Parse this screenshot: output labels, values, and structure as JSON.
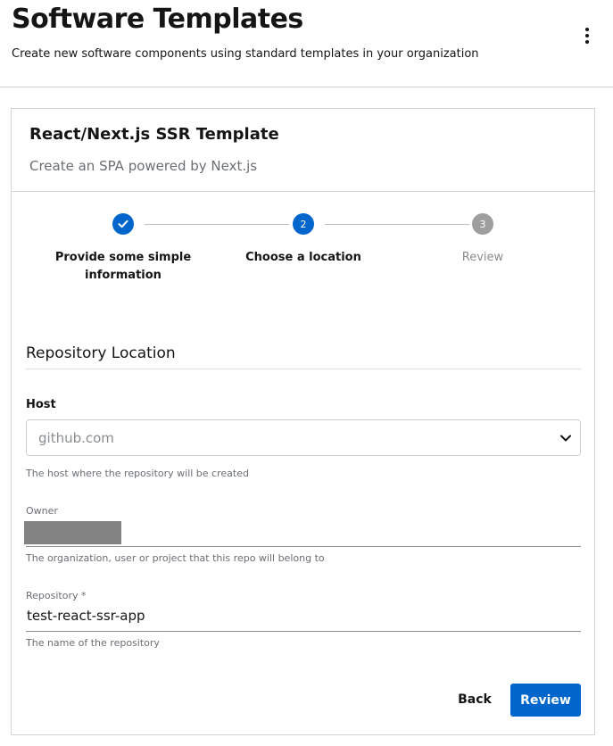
{
  "header": {
    "title": "Software Templates",
    "subtitle": "Create new software components using standard templates in your organization",
    "menu_icon": "kebab-menu-icon"
  },
  "template": {
    "title": "React/Next.js SSR Template",
    "description": "Create an SPA powered by Next.js"
  },
  "stepper": {
    "steps": [
      {
        "number": "1",
        "label": "Provide some simple information",
        "status": "completed",
        "icon": "check-icon"
      },
      {
        "number": "2",
        "label": "Choose a location",
        "status": "active"
      },
      {
        "number": "3",
        "label": "Review",
        "status": "pending"
      }
    ]
  },
  "form": {
    "section_title": "Repository Location",
    "host": {
      "label": "Host",
      "value": "github.com",
      "helper": "The host where the repository will be created"
    },
    "owner": {
      "label": "Owner",
      "value": "",
      "helper": "The organization, user or project that this repo will belong to"
    },
    "repository": {
      "label": "Repository *",
      "value": "test-react-ssr-app",
      "helper": "The name of the repository"
    }
  },
  "actions": {
    "back_label": "Back",
    "review_label": "Review"
  },
  "colors": {
    "accent": "#0066cc",
    "pending_step": "#9e9e9e"
  }
}
